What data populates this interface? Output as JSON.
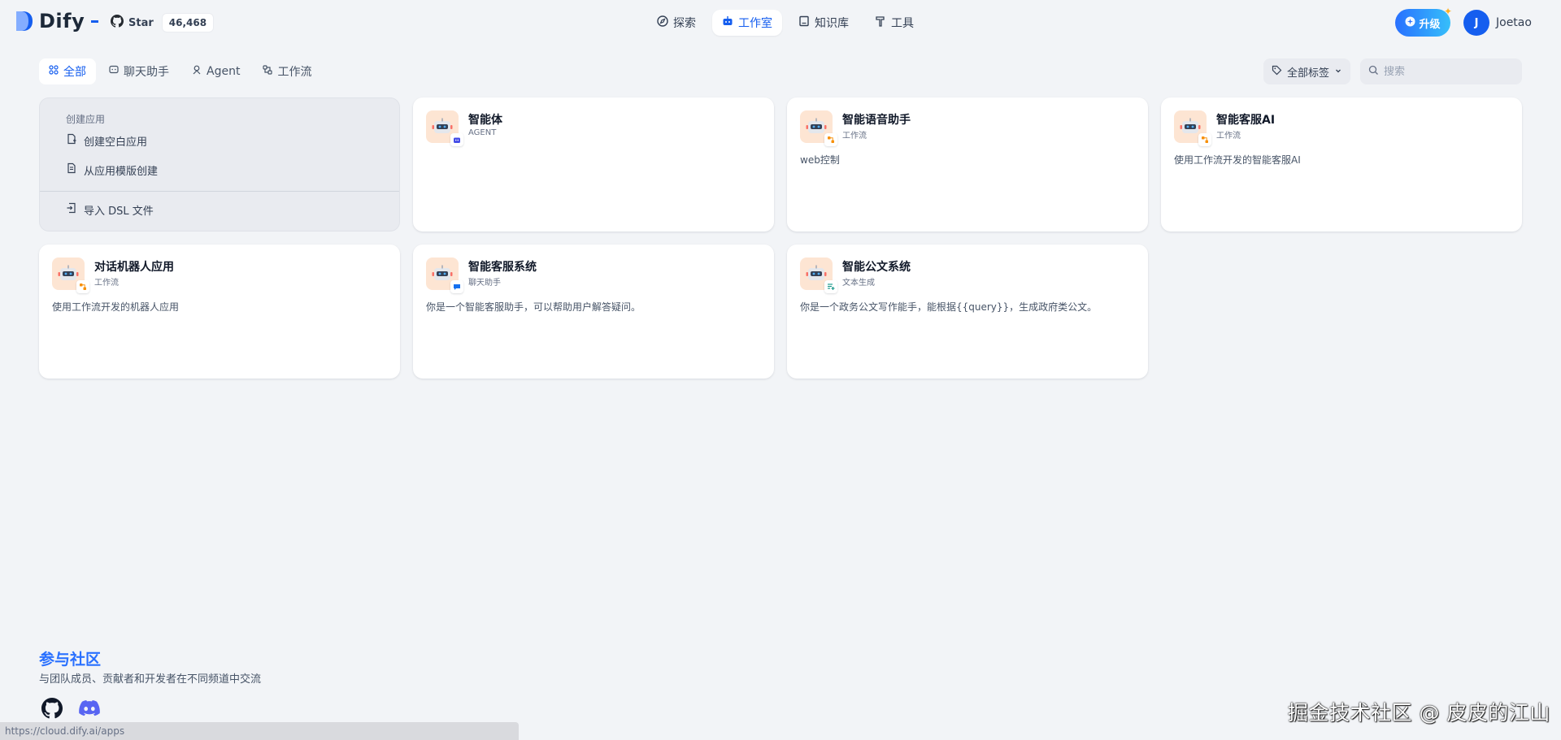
{
  "header": {
    "logo_text": "Dify",
    "github": {
      "star_label": "Star",
      "star_count": "46,468"
    },
    "nav": [
      {
        "label": "探索",
        "icon": "compass-icon"
      },
      {
        "label": "工作室",
        "icon": "robot-icon",
        "active": true
      },
      {
        "label": "知识库",
        "icon": "book-icon"
      },
      {
        "label": "工具",
        "icon": "hammer-icon"
      }
    ],
    "upgrade_label": "升级",
    "user": {
      "avatar_initial": "J",
      "name": "Joetao"
    }
  },
  "tabs": [
    {
      "label": "全部",
      "icon": "grid-icon",
      "active": true
    },
    {
      "label": "聊天助手",
      "icon": "chat-icon"
    },
    {
      "label": "Agent",
      "icon": "agent-icon"
    },
    {
      "label": "工作流",
      "icon": "workflow-icon"
    }
  ],
  "filters": {
    "tag_label": "全部标签",
    "search_placeholder": "搜索"
  },
  "create_panel": {
    "title": "创建应用",
    "blank": "创建空白应用",
    "template": "从应用模版创建",
    "import_dsl": "导入 DSL 文件"
  },
  "apps": [
    {
      "name": "智能体",
      "type": "AGENT",
      "desc": "",
      "badge": "agent-badge-icon"
    },
    {
      "name": "智能语音助手",
      "type": "工作流",
      "desc": "web控制",
      "badge": "workflow-badge-icon"
    },
    {
      "name": "智能客服AI",
      "type": "工作流",
      "desc": "使用工作流开发的智能客服AI",
      "badge": "workflow-badge-icon"
    },
    {
      "name": "对话机器人应用",
      "type": "工作流",
      "desc": "使用工作流开发的机器人应用",
      "badge": "workflow-badge-icon"
    },
    {
      "name": "智能客服系统",
      "type": "聊天助手",
      "desc": "你是一个智能客服助手，可以帮助用户解答疑问。",
      "badge": "chat-badge-icon"
    },
    {
      "name": "智能公文系统",
      "type": "文本生成",
      "desc": "你是一个政务公文写作能手，能根据{{query}}，生成政府类公文。",
      "badge": "text-gen-badge-icon"
    }
  ],
  "community": {
    "title": "参与社区",
    "subtitle": "与团队成员、贡献者和开发者在不同频道中交流",
    "icons": [
      "github-icon",
      "discord-icon"
    ]
  },
  "status_url": "https://cloud.dify.ai/apps",
  "watermark": "掘金技术社区 @ 皮皮的江山",
  "colors": {
    "primary": "#155eef",
    "background": "#f2f4f7",
    "icon_bg": "#fde5d3"
  }
}
